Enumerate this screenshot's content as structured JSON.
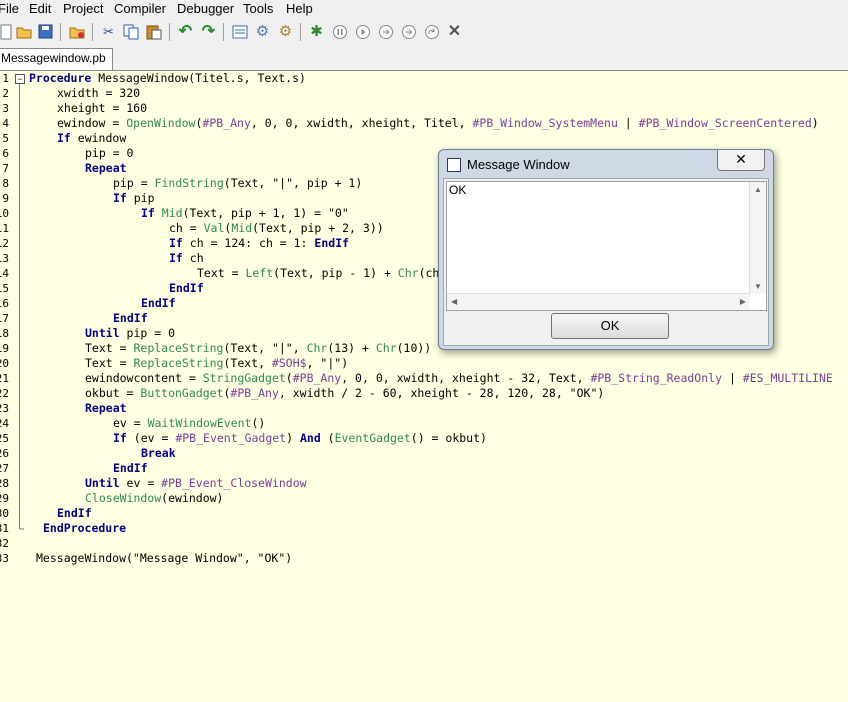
{
  "menu": {
    "file": "File",
    "edit": "Edit",
    "project": "Project",
    "compiler": "Compiler",
    "debugger": "Debugger",
    "tools": "Tools",
    "help": "Help"
  },
  "tab": {
    "label": "Messagewindow.pb"
  },
  "toolbar_icons": [
    "new-file-icon",
    "open-file-icon",
    "save-icon",
    "save-all-icon",
    "close-file-icon",
    "cut-icon",
    "copy-icon",
    "paste-icon",
    "undo-icon",
    "redo-icon",
    "procedure-browser-icon",
    "compile-run-icon",
    "compiler-options-icon",
    "debug-icon",
    "pause-icon",
    "continue-icon",
    "step-icon",
    "step-over-icon",
    "step-out-icon",
    "kill-icon"
  ],
  "lines": [
    "1",
    "2",
    "3",
    "4",
    "5",
    "6",
    "7",
    "8",
    "9",
    "10",
    "11",
    "12",
    "13",
    "14",
    "15",
    "16",
    "17",
    "18",
    "19",
    "20",
    "21",
    "22",
    "23",
    "24",
    "25",
    "26",
    "27",
    "28",
    "29",
    "30",
    "31",
    "32",
    "33"
  ],
  "code": {
    "l1": "Procedure MessageWindow(Titel.s, Text.s)",
    "l2": "xwidth = 320",
    "l3": "xheight = 160",
    "l4": "ewindow = OpenWindow(#PB_Any, 0, 0, xwidth, xheight, Titel, #PB_Window_SystemMenu | #PB_Window_ScreenCentered)",
    "l5": "If ewindow",
    "l6": "pip = 0",
    "l7": "Repeat",
    "l8": "pip = FindString(Text, \"|\", pip + 1)",
    "l9": "If pip",
    "l10": "If Mid(Text, pip + 1, 1) = \"0\"",
    "l11": "ch = Val(Mid(Text, pip + 2, 3))",
    "l12": "If ch = 124: ch = 1: EndIf",
    "l13": "If ch",
    "l14": "Text = Left(Text, pip - 1) + Chr(ch",
    "l15": "EndIf",
    "l16": "EndIf",
    "l17": "EndIf",
    "l18": "Until pip = 0",
    "l19": "Text = ReplaceString(Text, \"|\", Chr(13) + Chr(10))",
    "l20": "Text = ReplaceString(Text, #SOH$, \"|\")",
    "l21": "ewindowcontent = StringGadget(#PB_Any, 0, 0, xwidth, xheight - 32, Text, #PB_String_ReadOnly | #ES_MULTILINE",
    "l22": "okbut = ButtonGadget(#PB_Any, xwidth / 2 - 60, xheight - 28, 120, 28, \"OK\")",
    "l23": "Repeat",
    "l24": "ev = WaitWindowEvent()",
    "l25": "If (ev = #PB_Event_Gadget) And (EventGadget() = okbut)",
    "l26": "Break",
    "l27": "EndIf",
    "l28": "Until ev = #PB_Event_CloseWindow",
    "l29": "CloseWindow(ewindow)",
    "l30": "EndIf",
    "l31": "EndProcedure",
    "l32": "",
    "l33": "MessageWindow(\"Message Window\", \"OK\")"
  },
  "dialog": {
    "title": "Message Window",
    "close": "✕",
    "text": "OK",
    "ok_label": "OK"
  }
}
